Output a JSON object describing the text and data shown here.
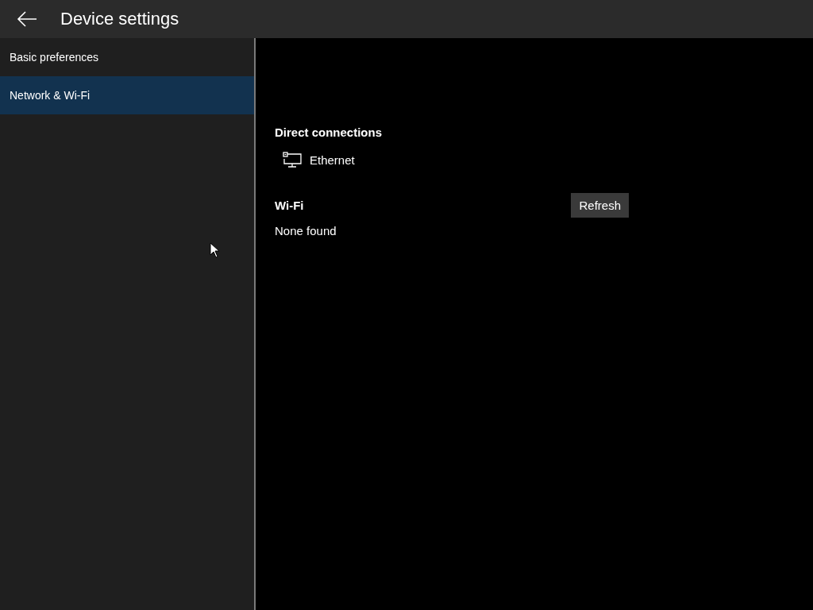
{
  "header": {
    "title": "Device settings"
  },
  "sidebar": {
    "items": [
      {
        "label": "Basic preferences",
        "selected": false
      },
      {
        "label": "Network & Wi-Fi",
        "selected": true
      }
    ]
  },
  "direct_connections": {
    "title": "Direct connections",
    "items": [
      {
        "label": "Ethernet"
      }
    ]
  },
  "wifi": {
    "title": "Wi-Fi",
    "refresh_button": "Refresh",
    "status": "None found"
  }
}
